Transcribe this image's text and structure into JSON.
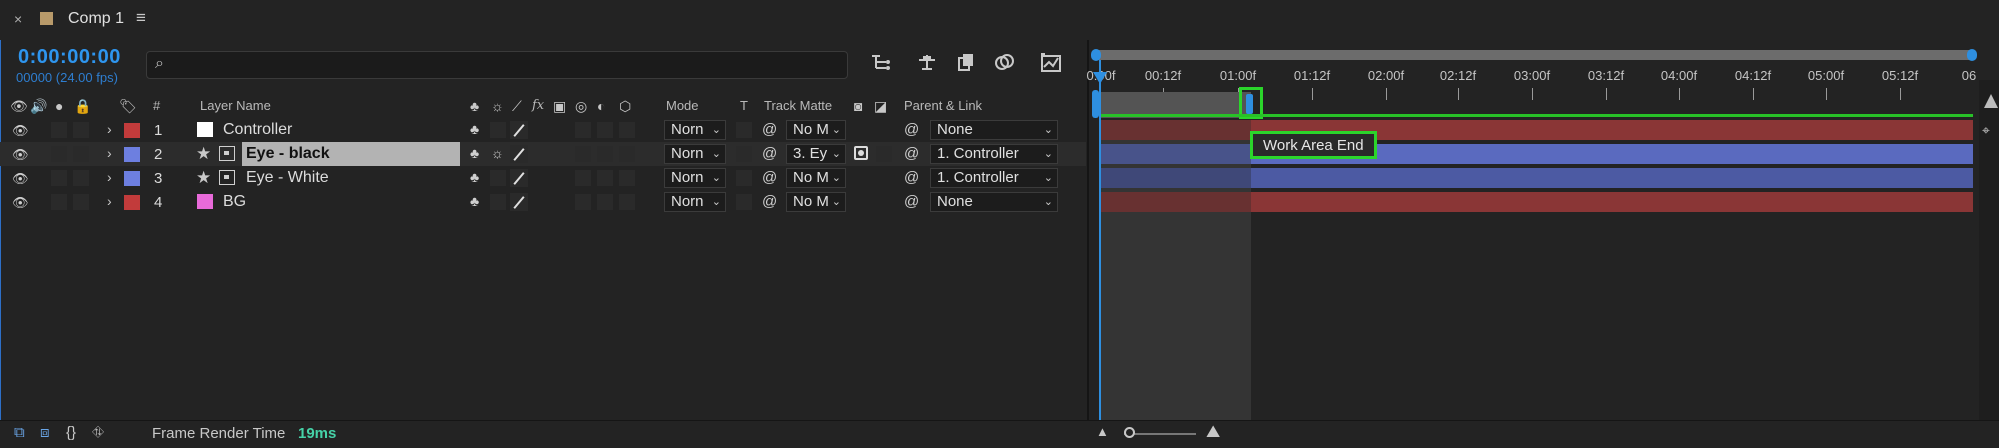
{
  "tab": {
    "title": "Comp 1",
    "close": "×",
    "menu": "≡"
  },
  "time": {
    "timecode": "0:00:00:00",
    "frames": "00000 (24.00 fps)"
  },
  "search": {
    "placeholder": "",
    "icon": "search-icon"
  },
  "columns": {
    "label": "Label",
    "num": "#",
    "layer_name": "Layer Name",
    "fx": "fx",
    "mode": "Mode",
    "t": "T",
    "track_matte": "Track Matte",
    "parent": "Parent & Link"
  },
  "layers": [
    {
      "num": "1",
      "name": "Controller",
      "label_color": "#c23b3b",
      "source_color": "#ffffff",
      "mode": "Norn",
      "matte": "No M",
      "parent": "None",
      "selected": false
    },
    {
      "num": "2",
      "name": "Eye - black",
      "label_color": "#6d7fe0",
      "mode": "Norn",
      "matte": "3. Ey",
      "parent": "1. Controller",
      "selected": true
    },
    {
      "num": "3",
      "name": "Eye - White",
      "label_color": "#6d7fe0",
      "mode": "Norn",
      "matte": "No M",
      "parent": "1. Controller",
      "selected": false
    },
    {
      "num": "4",
      "name": "BG",
      "label_color": "#c23b3b",
      "source_color": "#e86ad9",
      "mode": "Norn",
      "matte": "No M",
      "parent": "None",
      "selected": false
    }
  ],
  "ruler": [
    "0:00f",
    "00:12f",
    "01:00f",
    "01:12f",
    "02:00f",
    "02:12f",
    "03:00f",
    "03:12f",
    "04:00f",
    "04:12f",
    "05:00f",
    "05:12f",
    "06"
  ],
  "tooltip": "Work Area End",
  "bottom": {
    "render_label": "Frame Render Time",
    "render_value": "19ms"
  },
  "colors": {
    "accent": "#2e8fe0",
    "highlight": "#2bd52b",
    "red_bar": "#8a3636",
    "blue_bar": "#5a6abf"
  }
}
